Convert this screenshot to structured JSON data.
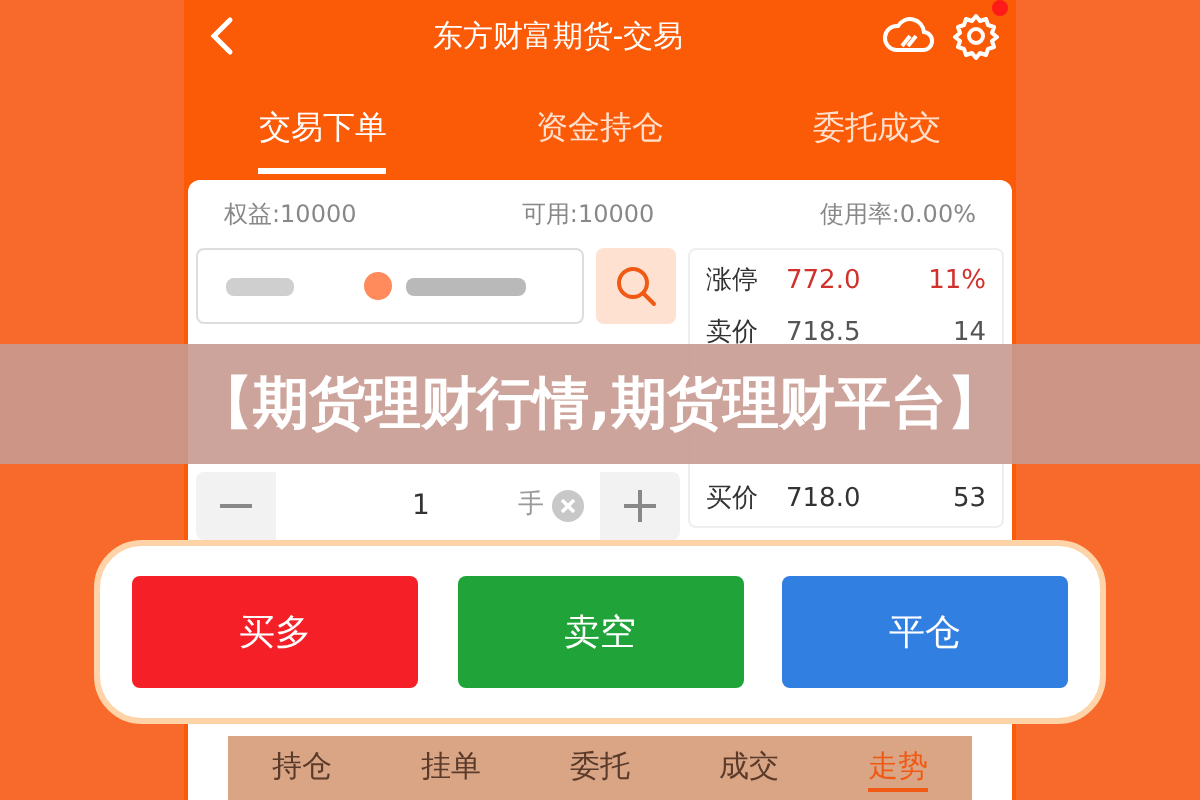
{
  "header": {
    "title": "东方财富期货-交易",
    "has_notification": true
  },
  "tabs": [
    {
      "label": "交易下单",
      "selected": true
    },
    {
      "label": "资金持仓",
      "selected": false
    },
    {
      "label": "委托成交",
      "selected": false
    }
  ],
  "account": [
    {
      "text": "权益:10000"
    },
    {
      "text": "可用:10000"
    },
    {
      "text": "使用率:0.00%"
    }
  ],
  "quantity": {
    "value": "1",
    "unit": "手"
  },
  "order_book": [
    {
      "label": "涨停",
      "price": "772.0",
      "volume": "11%",
      "color": "#d0312d"
    },
    {
      "label": "卖价",
      "price": "718.5",
      "volume": "14",
      "color": "#555555"
    },
    {
      "label": "买价",
      "price": "718.0",
      "volume": "53",
      "color": "#333333"
    }
  ],
  "banner": {
    "text": "【期货理财行情,期货理财平台】"
  },
  "actions": [
    {
      "label": "买多",
      "color": "#f52027"
    },
    {
      "label": "卖空",
      "color": "#20a43a"
    },
    {
      "label": "平仓",
      "color": "#327fe2"
    }
  ],
  "bottom_tabs": [
    {
      "label": "持仓",
      "selected": false
    },
    {
      "label": "挂单",
      "selected": false
    },
    {
      "label": "委托",
      "selected": false
    },
    {
      "label": "成交",
      "selected": false
    },
    {
      "label": "走势",
      "selected": true
    }
  ]
}
